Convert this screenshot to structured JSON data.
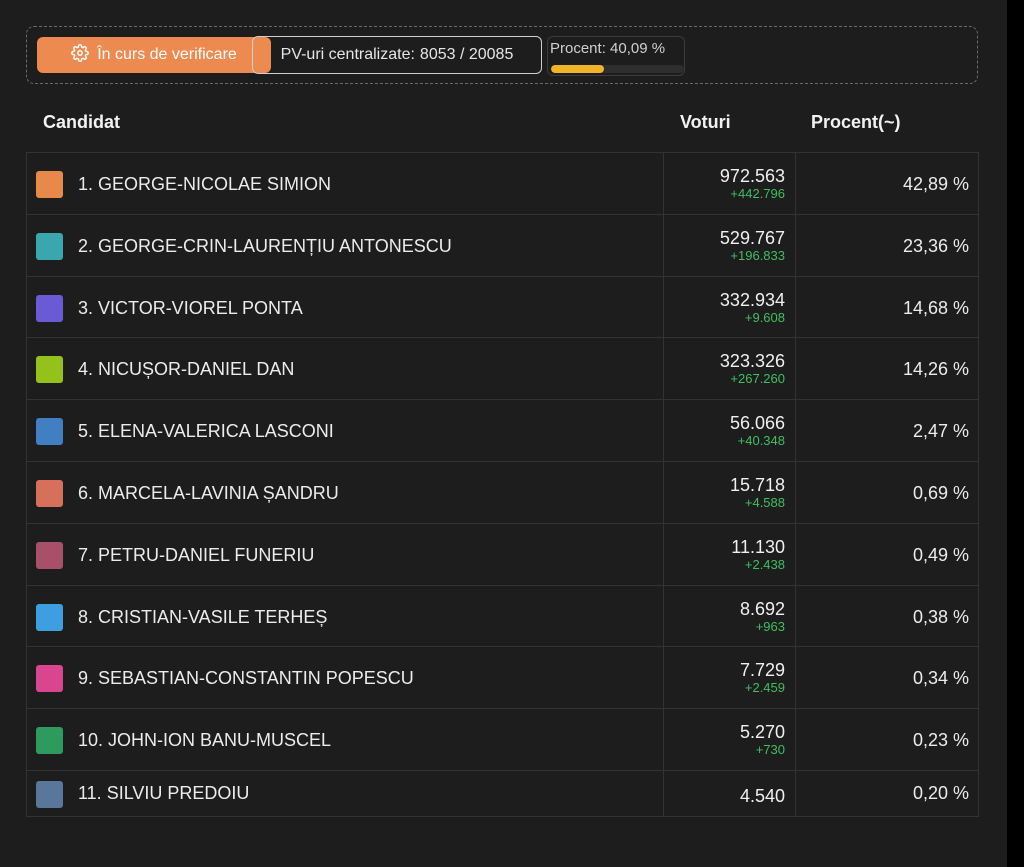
{
  "status": {
    "button_label": "În curs de verificare",
    "pv_label": "PV-uri centralizate:",
    "pv_value": "8053 / 20085",
    "procent_label": "Procent: 40,09 %",
    "procent_fill_fraction": 0.4009,
    "accent_color": "#ec8a4f",
    "bar_color": "#f0b429"
  },
  "table": {
    "headers": {
      "candidat": "Candidat",
      "voturi": "Voturi",
      "procent": "Procent(~)"
    },
    "rows": [
      {
        "name": "1. GEORGE-NICOLAE SIMION",
        "votes": "972.563",
        "delta": "+442.796",
        "pct": "42,89 %",
        "color": "#e8894a"
      },
      {
        "name": "2. GEORGE-CRIN-LAURENȚIU ANTONESCU",
        "votes": "529.767",
        "delta": "+196.833",
        "pct": "23,36 %",
        "color": "#3aa6ad"
      },
      {
        "name": "3. VICTOR-VIOREL PONTA",
        "votes": "332.934",
        "delta": "+9.608",
        "pct": "14,68 %",
        "color": "#6b5ad6"
      },
      {
        "name": "4. NICUȘOR-DANIEL DAN",
        "votes": "323.326",
        "delta": "+267.260",
        "pct": "14,26 %",
        "color": "#94c21a"
      },
      {
        "name": "5. ELENA-VALERICA LASCONI",
        "votes": "56.066",
        "delta": "+40.348",
        "pct": "2,47 %",
        "color": "#3f7fc2"
      },
      {
        "name": "6. MARCELA-LAVINIA ȘANDRU",
        "votes": "15.718",
        "delta": "+4.588",
        "pct": "0,69 %",
        "color": "#d6705a"
      },
      {
        "name": "7. PETRU-DANIEL FUNERIU",
        "votes": "11.130",
        "delta": "+2.438",
        "pct": "0,49 %",
        "color": "#a84f6a"
      },
      {
        "name": "8. CRISTIAN-VASILE TERHEȘ",
        "votes": "8.692",
        "delta": "+963",
        "pct": "0,38 %",
        "color": "#3e9fe0"
      },
      {
        "name": "9. SEBASTIAN-CONSTANTIN POPESCU",
        "votes": "7.729",
        "delta": "+2.459",
        "pct": "0,34 %",
        "color": "#d9468f"
      },
      {
        "name": "10. JOHN-ION BANU-MUSCEL",
        "votes": "5.270",
        "delta": "+730",
        "pct": "0,23 %",
        "color": "#2f9a5e"
      },
      {
        "name": "11. SILVIU PREDOIU",
        "votes": "4.540",
        "delta": "",
        "pct": "0,20 %",
        "color": "#58779a"
      }
    ]
  }
}
